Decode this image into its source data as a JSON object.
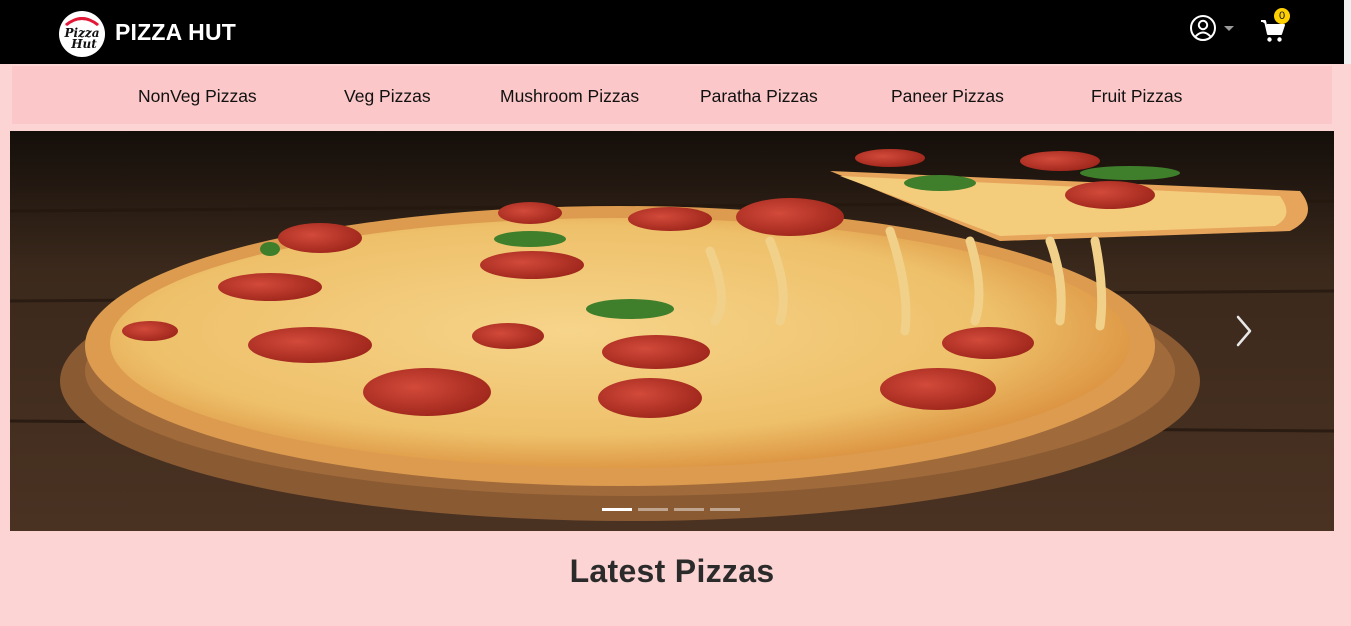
{
  "brand": {
    "name": "PIZZA HUT",
    "logo_icon": "pizza-hut-logo"
  },
  "header": {
    "user_icon": "user-circle-icon",
    "cart_icon": "shopping-cart-icon",
    "cart_count": "0"
  },
  "categories": [
    {
      "label": "NonVeg Pizzas"
    },
    {
      "label": "Veg Pizzas"
    },
    {
      "label": "Mushroom Pizzas"
    },
    {
      "label": "Paratha Pizzas"
    },
    {
      "label": "Paneer Pizzas"
    },
    {
      "label": "Fruit Pizzas"
    }
  ],
  "carousel": {
    "slide_icon": "pepperoni-pizza-photo",
    "slide_count": 4,
    "active_slide": 1
  },
  "sections": {
    "latest_title": "Latest Pizzas"
  },
  "colors": {
    "navbar": "#000000",
    "page_background": "#fbd4d3",
    "category_bar": "#fbc7c8",
    "badge": "#ffd000"
  }
}
